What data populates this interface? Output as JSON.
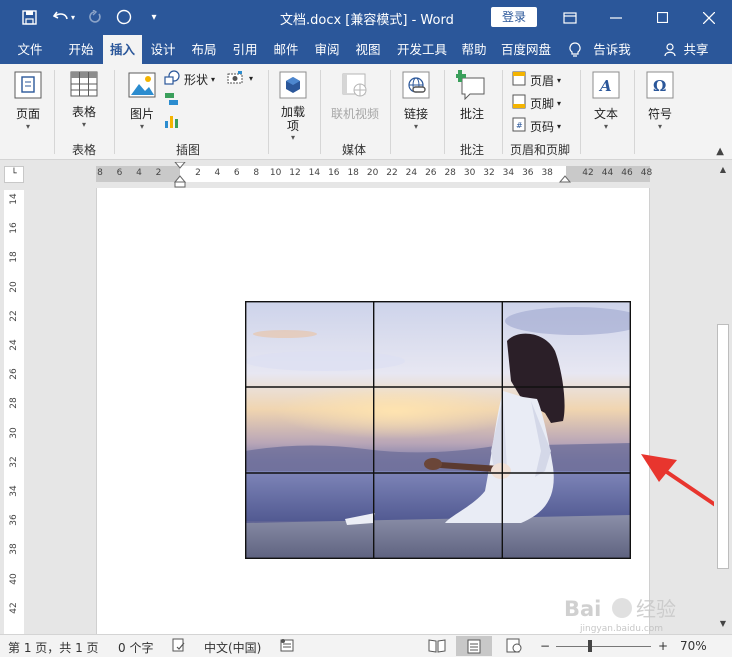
{
  "titlebar": {
    "doc_title": "文档.docx [兼容模式] - Word",
    "login_label": "登录",
    "quick_access": [
      "save-icon",
      "undo-icon",
      "redo-icon",
      "circle-icon",
      "customize-icon"
    ]
  },
  "tabs": [
    "文件",
    "开始",
    "插入",
    "设计",
    "布局",
    "引用",
    "邮件",
    "审阅",
    "视图",
    "开发工具",
    "帮助",
    "百度网盘",
    "告诉我",
    "共享"
  ],
  "ribbon": {
    "page_label": "页面",
    "table_label": "表格",
    "table_group": "表格",
    "picture_label": "图片",
    "shapes_label": "形状",
    "illustrations_group": "插图",
    "addins_label": "加载\n项",
    "online_video_label": "联机视频",
    "media_group": "媒体",
    "link_label": "链接",
    "comment_label": "批注",
    "comments_group": "批注",
    "header_label": "页眉",
    "footer_label": "页脚",
    "pagenum_label": "页码",
    "headerfooter_group": "页眉和页脚",
    "text_label": "文本",
    "symbol_label": "符号"
  },
  "ruler": {
    "h_left": [
      "8",
      "6",
      "4",
      "2"
    ],
    "h_right": [
      "2",
      "4",
      "6",
      "8",
      "10",
      "12",
      "14",
      "16",
      "18",
      "20",
      "22",
      "24",
      "26",
      "28",
      "30",
      "32",
      "34",
      "36",
      "38"
    ],
    "h_far": [
      "42",
      "44",
      "46",
      "48"
    ],
    "v": [
      "14",
      "16",
      "18",
      "20",
      "22",
      "24",
      "26",
      "28",
      "30",
      "32",
      "34",
      "36",
      "38",
      "40",
      "42"
    ]
  },
  "statusbar": {
    "page_info": "第 1 页，共 1 页",
    "word_count": "0 个字",
    "language": "中文(中国)",
    "zoom_minus": "−",
    "zoom_plus": "+",
    "zoom_level": "70%"
  },
  "watermark": {
    "brand": "Bai 经验",
    "url": "jingyan.baidu.com"
  },
  "colors": {
    "title_bg": "#2b579a",
    "ribbon_bg": "#f3f3f3",
    "arrow": "#e8352e"
  }
}
